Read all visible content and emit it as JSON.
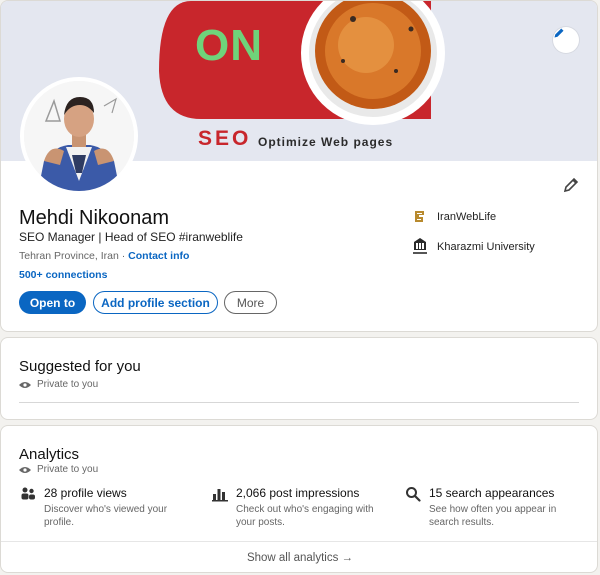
{
  "banner": {
    "on_text": "ON",
    "seo_text": "SEO",
    "seo_tagline": "Optimize Web pages"
  },
  "profile": {
    "name": "Mehdi Nikoonam",
    "headline": "SEO Manager | Head of SEO #iranweblife",
    "location": "Tehran Province, Iran",
    "separator": " · ",
    "contact_label": "Contact info",
    "connections": "500+ connections"
  },
  "actions": {
    "open_to": "Open to",
    "add_section": "Add profile section",
    "more": "More"
  },
  "organizations": [
    {
      "name": "IranWebLife",
      "icon": "company-logo-icon"
    },
    {
      "name": "Kharazmi University",
      "icon": "university-logo-icon"
    }
  ],
  "suggested": {
    "title": "Suggested for you",
    "privacy": "Private to you"
  },
  "analytics": {
    "title": "Analytics",
    "privacy": "Private to you",
    "metrics": [
      {
        "title": "28 profile views",
        "desc": "Discover who's viewed your profile.",
        "icon": "people-icon"
      },
      {
        "title": "2,066 post impressions",
        "desc": "Check out who's engaging with your posts.",
        "icon": "bar-chart-icon"
      },
      {
        "title": "15 search appearances",
        "desc": "See how often you appear in search results.",
        "icon": "search-icon"
      }
    ],
    "show_all": "Show all analytics →"
  },
  "colors": {
    "accent": "#0a66c2",
    "banner_red": "#c8262c",
    "on_green": "#6fd37a"
  }
}
